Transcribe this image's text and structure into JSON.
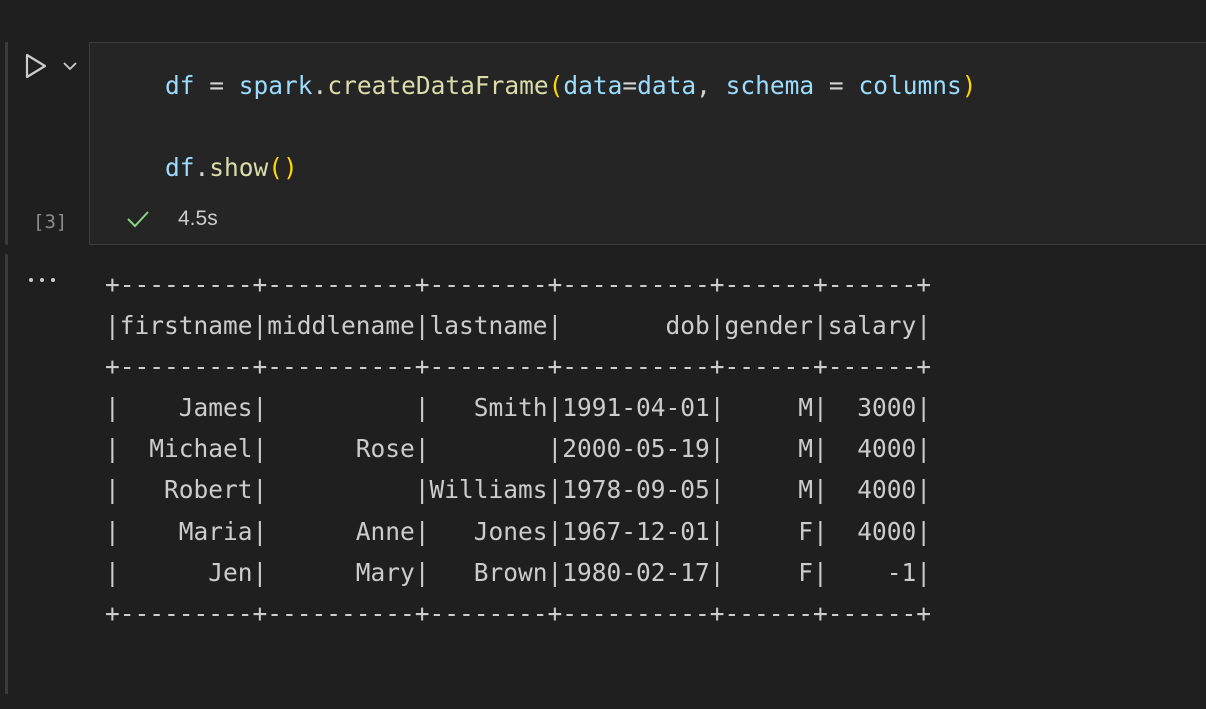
{
  "cell": {
    "execution_count": "[3]",
    "code": {
      "line1": {
        "t1": "df",
        "t2": " = ",
        "t3": "spark",
        "t4": ".",
        "t5": "createDataFrame",
        "t6": "(",
        "t7": "data",
        "t8": "=",
        "t9": "data",
        "t10": ", ",
        "t11": "schema",
        "t12": " = ",
        "t13": "columns",
        "t14": ")"
      },
      "line2": {
        "t1": "df",
        "t2": ".",
        "t3": "show",
        "t4": "()"
      }
    },
    "status": {
      "icon": "check-icon",
      "duration": "4.5s"
    },
    "colors": {
      "variable": "#9cdcfe",
      "function": "#dcdcaa",
      "bracket": "#ffd700",
      "success": "#89d185"
    }
  },
  "output": {
    "more_icon": "ellipsis-icon",
    "table": {
      "border": "+---------+----------+--------+----------+------+------+",
      "header": "|firstname|middlename|lastname|       dob|gender|salary|",
      "rows": [
        "|    James|          |   Smith|1991-04-01|     M|  3000|",
        "|  Michael|      Rose|        |2000-05-19|     M|  4000|",
        "|   Robert|          |Williams|1978-09-05|     M|  4000|",
        "|    Maria|      Anne|   Jones|1967-12-01|     F|  4000|",
        "|      Jen|      Mary|   Brown|1980-02-17|     F|    -1|"
      ]
    }
  }
}
